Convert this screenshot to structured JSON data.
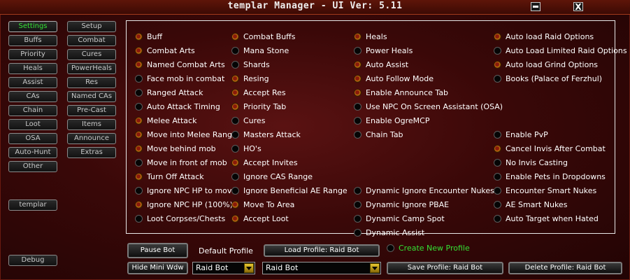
{
  "window": {
    "title": "templar Manager  - UI Ver: 5.11",
    "close_label": "X"
  },
  "nav_left": [
    "Settings",
    "Buffs",
    "Priority",
    "Heals",
    "Assist",
    "CAs",
    "Chain",
    "Loot",
    "OSA",
    "Auto-Hunt",
    "Other"
  ],
  "nav_right": [
    "Setup",
    "Combat",
    "Cures",
    "PowerHeals",
    "Res",
    "Named CAs",
    "Pre-Cast",
    "Items",
    "Announce",
    "Extras"
  ],
  "class_button": "templar",
  "debug_button": "Debug",
  "options": [
    {
      "label": "Buff",
      "on": true
    },
    {
      "label": "Combat Arts",
      "on": true
    },
    {
      "label": "Named Combat Arts",
      "on": true
    },
    {
      "label": "Face mob in combat",
      "on": false
    },
    {
      "label": "Ranged Attack",
      "on": false
    },
    {
      "label": "Auto Attack Timing",
      "on": false
    },
    {
      "label": "Melee Attack",
      "on": true
    },
    {
      "label": "Move into Melee Range",
      "on": true
    },
    {
      "label": "Move behind mob",
      "on": true
    },
    {
      "label": "Move in front of mob",
      "on": false
    },
    {
      "label": "Turn Off Attack",
      "on": true
    },
    {
      "label": "Ignore NPC HP to move",
      "on": false
    },
    {
      "label": "Ignore NPC HP (100%)",
      "on": true
    },
    {
      "label": "Loot Corpses/Chests",
      "on": false
    },
    {
      "label": "Combat Buffs",
      "on": true
    },
    {
      "label": "Mana Stone",
      "on": false
    },
    {
      "label": "Shards",
      "on": false
    },
    {
      "label": "Resing",
      "on": true
    },
    {
      "label": "Accept Res",
      "on": true
    },
    {
      "label": "Priority Tab",
      "on": true
    },
    {
      "label": "Cures",
      "on": false
    },
    {
      "label": "Masters Attack",
      "on": false
    },
    {
      "label": "HO's",
      "on": false
    },
    {
      "label": "Accept Invites",
      "on": true
    },
    {
      "label": "Ignore CAS Range",
      "on": false
    },
    {
      "label": "Ignore Beneficial AE Range",
      "on": false
    },
    {
      "label": "Move To Area",
      "on": true
    },
    {
      "label": "Accept Loot",
      "on": true
    },
    {
      "label": "Heals",
      "on": true
    },
    {
      "label": "Power Heals",
      "on": false
    },
    {
      "label": "Auto Assist",
      "on": true
    },
    {
      "label": "Auto Follow Mode",
      "on": true
    },
    {
      "label": "Enable Announce Tab",
      "on": true
    },
    {
      "label": "Use NPC On Screen Assistant (OSA)",
      "on": false
    },
    {
      "label": "Enable OgreMCP",
      "on": false
    },
    {
      "label": "Chain Tab",
      "on": false
    },
    {
      "label": "Dynamic Ignore Encounter Nukes",
      "on": false
    },
    {
      "label": "Dynamic Ignore PBAE",
      "on": false
    },
    {
      "label": "Dynamic Camp Spot",
      "on": false
    },
    {
      "label": "Dynamic Assist",
      "on": false
    },
    {
      "label": "Auto load Raid Options",
      "on": true
    },
    {
      "label": "Auto Load Limited Raid Options",
      "on": false
    },
    {
      "label": "Auto load Grind Options",
      "on": true
    },
    {
      "label": "Books (Palace of Ferzhul)",
      "on": false
    },
    {
      "label": "Enable PvP",
      "on": false
    },
    {
      "label": "Cancel Invis After Combat",
      "on": true
    },
    {
      "label": "No Invis Casting",
      "on": false
    },
    {
      "label": "Enable Pets in Dropdowns",
      "on": false
    },
    {
      "label": "Encounter Smart Nukes",
      "on": false
    },
    {
      "label": "AE Smart Nukes",
      "on": false
    },
    {
      "label": "Auto Target when Hated",
      "on": false
    }
  ],
  "bottom": {
    "pause_bot": "Pause Bot",
    "default_profile_label": "Default Profile",
    "load_profile": "Load Profile: Raid Bot",
    "create_new_profile": "Create New Profile",
    "hide_mini_wdw": "Hide Mini Wdw",
    "default_profile_value": "Raid Bot",
    "profile_value": "Raid Bot",
    "save_profile": "Save Profile: Raid Bot",
    "delete_profile": "Delete Profile: Raid Bot"
  },
  "colors": {
    "accent_green": "#34e034",
    "radio_on": "#c07a10",
    "background": "#3a0808"
  }
}
